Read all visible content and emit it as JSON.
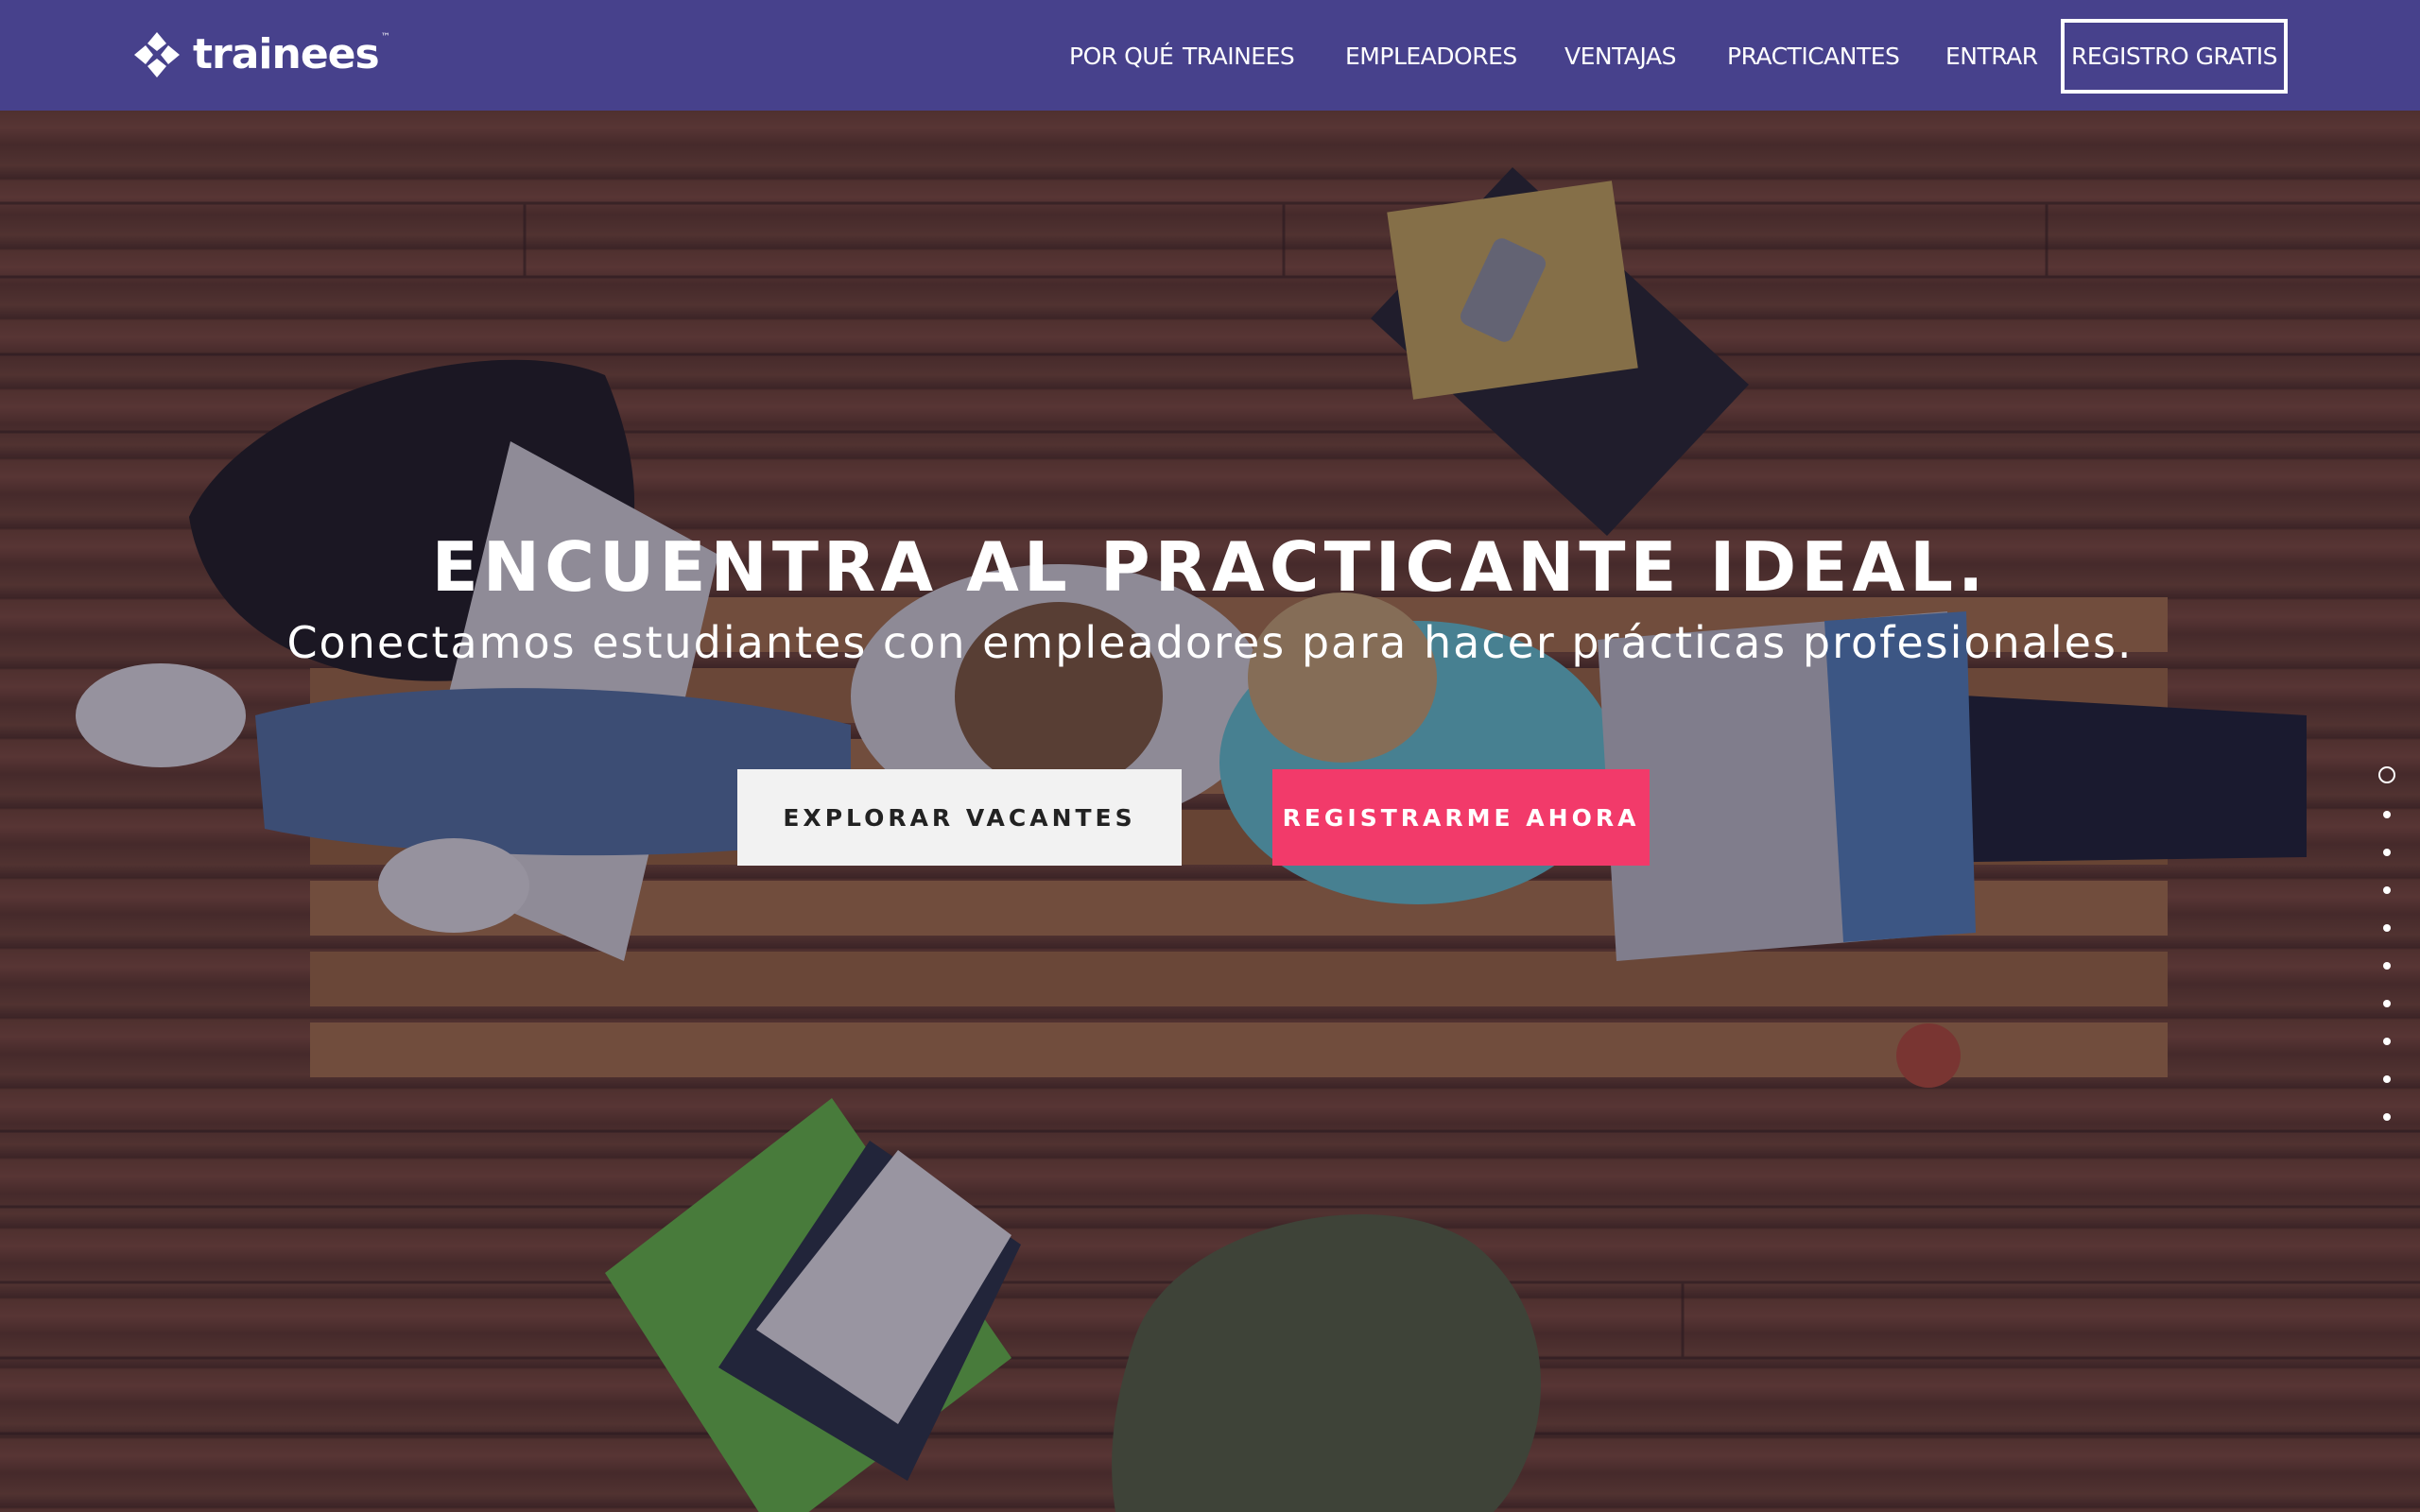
{
  "brand": {
    "name": "trainees",
    "tm": "™"
  },
  "nav": {
    "links": [
      "POR QUÉ",
      "TRAINEES",
      "EMPLEADORES",
      "VENTAJAS",
      "PRACTICANTES",
      "ENTRAR"
    ],
    "cta": "REGISTRO GRATIS"
  },
  "hero": {
    "title": "ENCUENTRA AL PRACTICANTE IDEAL.",
    "subtitle": "Conectamos estudiantes con empleadores para hacer prácticas profesionales.",
    "explore_label": "EXPLORAR VACANTES",
    "register_label": "REGISTRARME AHORA"
  },
  "pagination": {
    "total": 10,
    "active_index": 0
  },
  "colors": {
    "nav_bg": "#47418c",
    "cta_pink": "#f23a6a",
    "explore_bg": "#f2f2f2"
  }
}
